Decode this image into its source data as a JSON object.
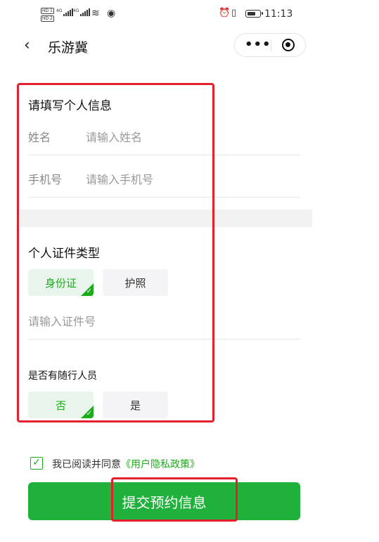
{
  "status_bar": {
    "hd1": "HD 1",
    "hd2": "HD 2",
    "net1": "4G",
    "net2": "4G",
    "time": "11:13"
  },
  "nav": {
    "title": "乐游冀",
    "more_glyph": "•••"
  },
  "personal_info": {
    "section_title": "请填写个人信息",
    "name_label": "姓名",
    "name_placeholder": "请输入姓名",
    "phone_label": "手机号",
    "phone_placeholder": "请输入手机号"
  },
  "id_type": {
    "section_title": "个人证件类型",
    "options": [
      {
        "label": "身份证",
        "selected": true
      },
      {
        "label": "护照",
        "selected": false
      }
    ],
    "id_placeholder": "请输入证件号"
  },
  "companions": {
    "section_title": "是否有随行人员",
    "options": [
      {
        "label": "否",
        "selected": true
      },
      {
        "label": "是",
        "selected": false
      }
    ]
  },
  "agreement": {
    "checked": true,
    "text": "我已阅读并同意",
    "link": "《用户隐私政策》"
  },
  "submit_label": "提交预约信息",
  "colors": {
    "accent": "#1aad19",
    "button": "#20b03c",
    "highlight_box": "#e5202d"
  }
}
